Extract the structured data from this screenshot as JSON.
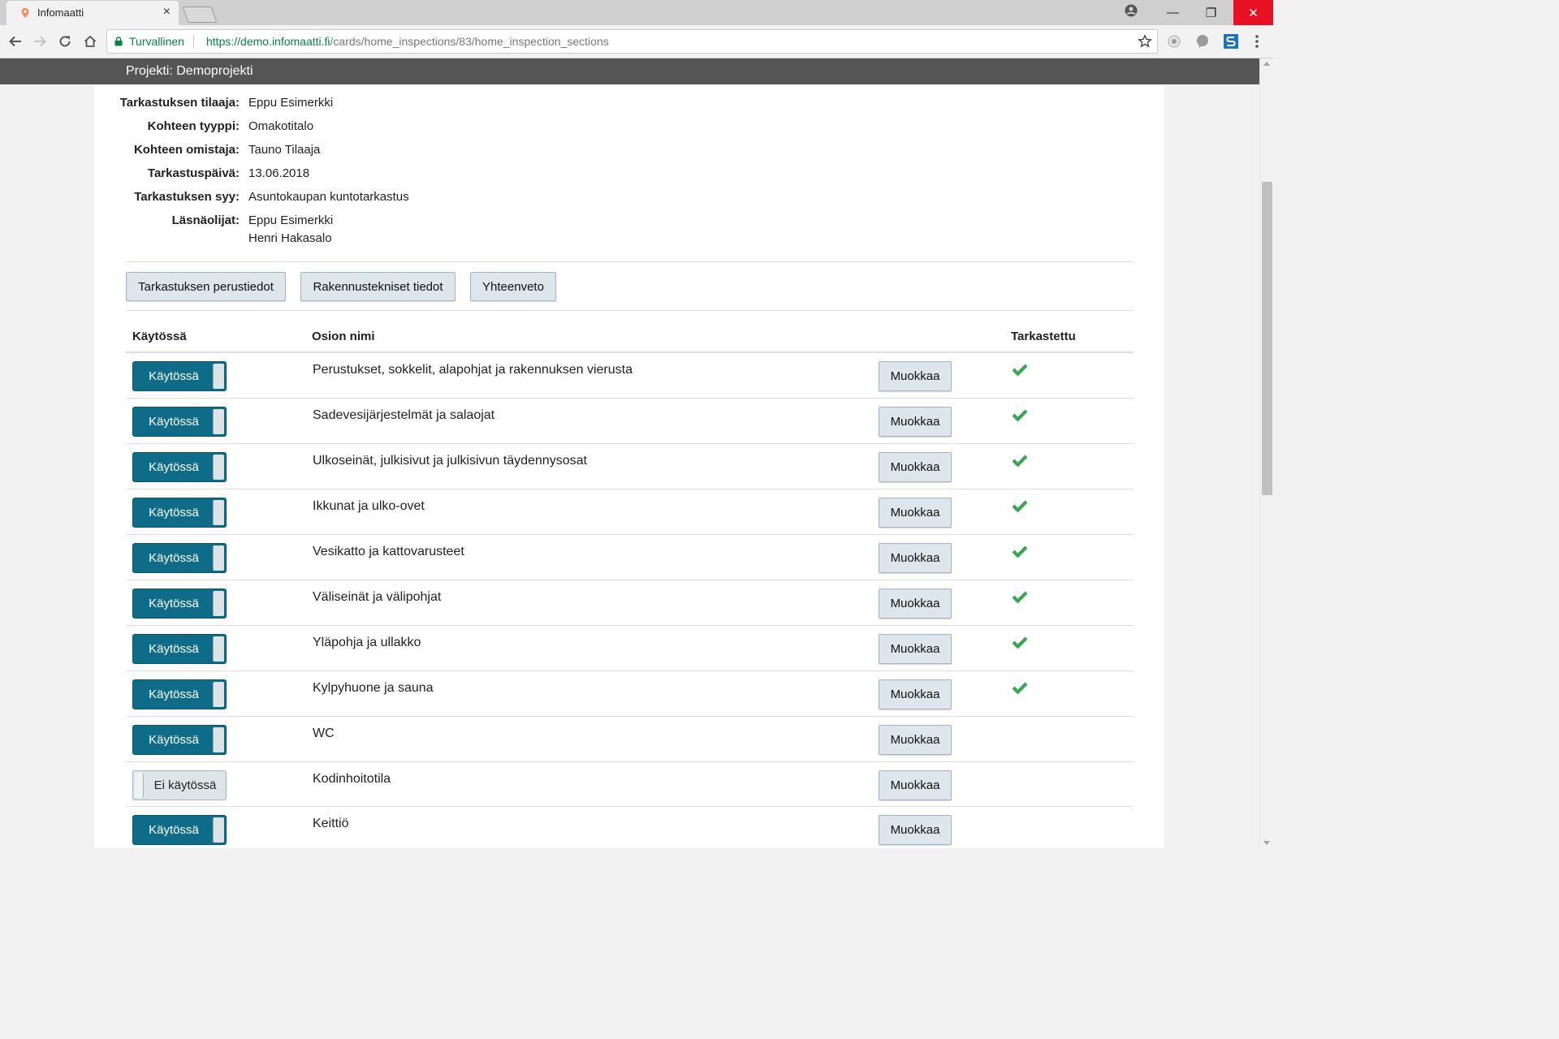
{
  "browser": {
    "tab_title": "Infomaatti",
    "tab_close": "×",
    "secure_label": "Turvallinen",
    "url_scheme": "https://",
    "url_host": "demo.infomaatti.fi",
    "url_path": "/cards/home_inspections/83/home_inspection_sections",
    "win_minimize": "—",
    "win_restore": "❐",
    "win_close": "✕"
  },
  "project": {
    "title": "Projekti: Demoprojekti"
  },
  "info": [
    {
      "label": "Tarkastuksen tilaaja:",
      "value": "Eppu Esimerkki"
    },
    {
      "label": "Kohteen tyyppi:",
      "value": "Omakotitalo"
    },
    {
      "label": "Kohteen omistaja:",
      "value": "Tauno Tilaaja"
    },
    {
      "label": "Tarkastuspäivä:",
      "value": "13.06.2018"
    },
    {
      "label": "Tarkastuksen syy:",
      "value": "Asuntokaupan kuntotarkastus"
    },
    {
      "label": "Läsnäolijat:",
      "value": "Eppu Esimerkki",
      "value2": "Henri Hakasalo"
    }
  ],
  "tabs": [
    {
      "label": "Tarkastuksen perustiedot"
    },
    {
      "label": "Rakennustekniset tiedot"
    },
    {
      "label": "Yhteenveto"
    }
  ],
  "table": {
    "headers": {
      "enabled": "Käytössä",
      "name": "Osion nimi",
      "checked": "Tarkastettu"
    },
    "edit_label": "Muokkaa",
    "rows": [
      {
        "toggle": "Käytössä",
        "enabled": true,
        "name": "Perustukset, sokkelit, alapohjat ja rakennuksen vierusta",
        "checked": true
      },
      {
        "toggle": "Käytössä",
        "enabled": true,
        "name": "Sadevesijärjestelmät ja salaojat",
        "checked": true
      },
      {
        "toggle": "Käytössä",
        "enabled": true,
        "name": "Ulkoseinät, julkisivut ja julkisivun täydennysosat",
        "checked": true
      },
      {
        "toggle": "Käytössä",
        "enabled": true,
        "name": "Ikkunat ja ulko-ovet",
        "checked": true
      },
      {
        "toggle": "Käytössä",
        "enabled": true,
        "name": "Vesikatto ja kattovarusteet",
        "checked": true
      },
      {
        "toggle": "Käytössä",
        "enabled": true,
        "name": "Väliseinät ja välipohjat",
        "checked": true
      },
      {
        "toggle": "Käytössä",
        "enabled": true,
        "name": "Yläpohja ja ullakko",
        "checked": true
      },
      {
        "toggle": "Käytössä",
        "enabled": true,
        "name": "Kylpyhuone ja sauna",
        "checked": true
      },
      {
        "toggle": "Käytössä",
        "enabled": true,
        "name": "WC",
        "checked": false
      },
      {
        "toggle": "Ei käytössä",
        "enabled": false,
        "name": "Kodinhoitotila",
        "checked": false
      },
      {
        "toggle": "Käytössä",
        "enabled": true,
        "name": "Keittiö",
        "checked": false
      }
    ]
  },
  "colors": {
    "toggle_on": "#0e6c89",
    "check": "#3aa655",
    "secure": "#0b8043",
    "project_bar": "#555555"
  }
}
